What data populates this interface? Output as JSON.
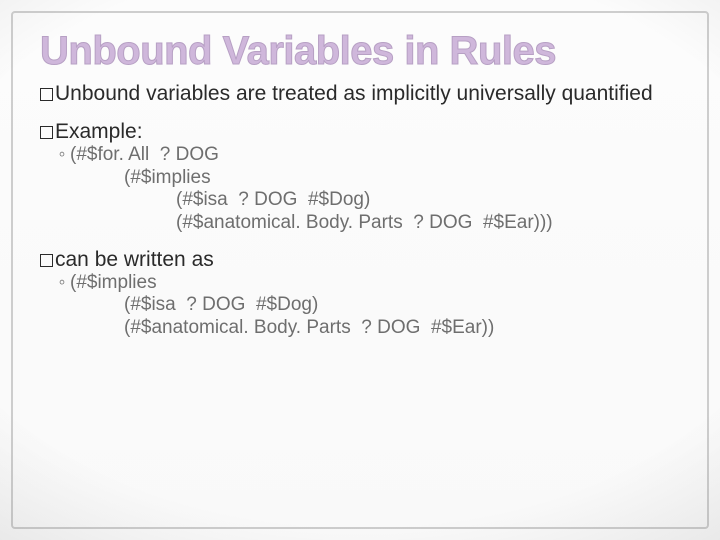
{
  "title": "Unbound Variables in Rules",
  "blocks": [
    {
      "lead": "Unbound variables are treated as implicitly universally quantified",
      "sub": null
    },
    {
      "lead": "Example:",
      "sub": [
        {
          "cls": "sub",
          "open": true,
          "text": "(#$for. All  ? DOG"
        },
        {
          "cls": "indent1",
          "open": false,
          "text": "(#$implies"
        },
        {
          "cls": "indent2",
          "open": false,
          "text": "(#$isa  ? DOG  #$Dog)"
        },
        {
          "cls": "indent2",
          "open": false,
          "text": "(#$anatomical. Body. Parts  ? DOG  #$Ear)))"
        }
      ]
    },
    {
      "lead": "can be written as",
      "sub": [
        {
          "cls": "sub",
          "open": true,
          "text": "(#$implies"
        },
        {
          "cls": "indent1",
          "open": false,
          "text": "(#$isa  ? DOG  #$Dog)"
        },
        {
          "cls": "indent1",
          "open": false,
          "text": "(#$anatomical. Body. Parts  ? DOG  #$Ear))"
        }
      ]
    }
  ]
}
